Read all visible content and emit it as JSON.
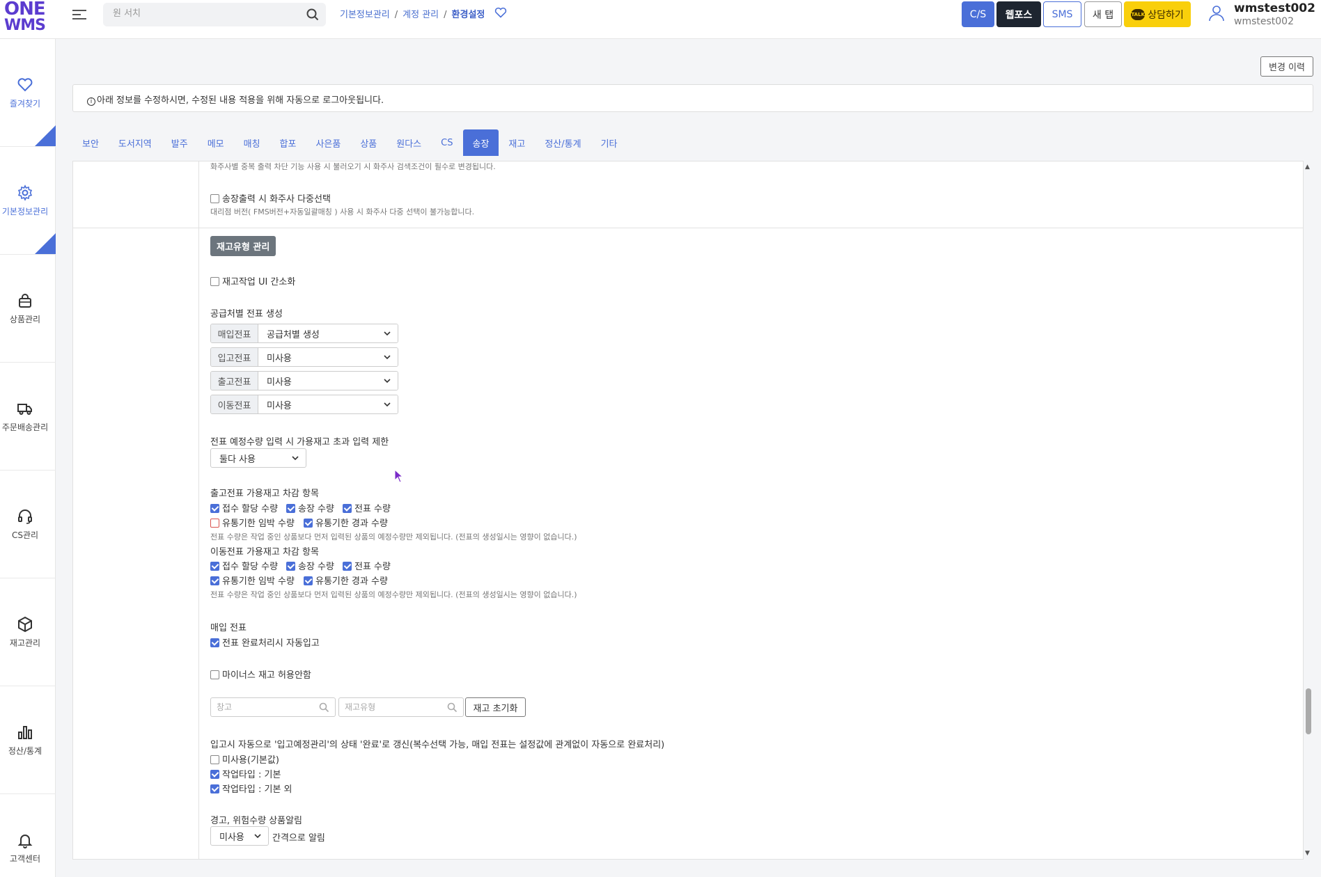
{
  "logo": {
    "line1": "ONE",
    "line2": "WMS"
  },
  "search": {
    "placeholder": "원 서치"
  },
  "breadcrumb": {
    "item1": "기본정보관리",
    "item2": "계정 관리",
    "current": "환경설정"
  },
  "topbar": {
    "cs": "C/S",
    "webpos": "웹포스",
    "sms": "SMS",
    "newtab": "새 탭",
    "talk_badge": "TALK",
    "consult": "상담하기"
  },
  "user": {
    "name": "wmstest002",
    "id": "wmstest002"
  },
  "sidebar": {
    "items": [
      {
        "label": "즐겨찾기",
        "icon": "heart-icon"
      },
      {
        "label": "기본정보관리",
        "icon": "gear-icon"
      },
      {
        "label": "상품관리",
        "icon": "bag-icon"
      },
      {
        "label": "주문배송관리",
        "icon": "truck-icon"
      },
      {
        "label": "CS관리",
        "icon": "headset-icon"
      },
      {
        "label": "재고관리",
        "icon": "box-icon"
      },
      {
        "label": "정산/통계",
        "icon": "bar-chart-icon"
      },
      {
        "label": "고객센터",
        "icon": "bell-icon"
      }
    ]
  },
  "history_btn": "변경 이력",
  "notice": "아래 정보를 수정하시면, 수정된 내용 적용을 위해 자동으로 로그아웃됩니다.",
  "tabs": [
    "보안",
    "도서지역",
    "발주",
    "메모",
    "매칭",
    "합포",
    "사은품",
    "상품",
    "원다스",
    "CS",
    "송장",
    "재고",
    "정산/통계",
    "기타"
  ],
  "active_tab": "송장",
  "top_section": {
    "note1": "화주사별 중복 출력 차단 기능 사용 시 불러오기 시 화주사 검색조건이 필수로 변경됩니다.",
    "multi_select_label": "송장출력 시 화주사 다중선택",
    "note2": "대리점 버전( FMS버전+자동일괄매칭 ) 사용 시 화주사 다중 선택이 불가능합니다."
  },
  "stock_section": {
    "title": "재고유형 관리",
    "simplify_label": "재고작업 UI 간소화",
    "supplier_slip_title": "공급처별 전표 생성",
    "slips": [
      {
        "addon": "매입전표",
        "value": "공급처별 생성"
      },
      {
        "addon": "입고전표",
        "value": "미사용"
      },
      {
        "addon": "출고전표",
        "value": "미사용"
      },
      {
        "addon": "이동전표",
        "value": "미사용"
      }
    ],
    "limit_title": "전표 예정수량 입력 시 가용재고 초과 입력 제한",
    "limit_value": "둘다 사용",
    "out_title": "출고전표 가용재고 차감 항목",
    "out_items": [
      {
        "label": "접수 할당 수량",
        "checked": true
      },
      {
        "label": "송장 수량",
        "checked": true
      },
      {
        "label": "전표 수량",
        "checked": true
      },
      {
        "label": "유통기한 임박 수량",
        "checked": false
      },
      {
        "label": "유통기한 경과 수량",
        "checked": true
      }
    ],
    "out_note": "전표 수량은 작업 중인 상품보다 먼저 입력된 상품의 예정수량만 제외됩니다. (전표의 생성일시는 영향이 없습니다.)",
    "move_title": "이동전표 가용재고 차감 항목",
    "move_items": [
      {
        "label": "접수 할당 수량",
        "checked": true
      },
      {
        "label": "송장 수량",
        "checked": true
      },
      {
        "label": "전표 수량",
        "checked": true
      },
      {
        "label": "유통기한 임박 수량",
        "checked": true
      },
      {
        "label": "유통기한 경과 수량",
        "checked": true
      }
    ],
    "move_note": "전표 수량은 작업 중인 상품보다 먼저 입력된 상품의 예정수량만 제외됩니다. (전표의 생성일시는 영향이 없습니다.)",
    "purchase_title": "매입 전표",
    "purchase_auto": "전표 완료처리시 자동입고",
    "minus_label": "마이너스 재고 허용안함",
    "warehouse_placeholder": "창고",
    "stocktype_placeholder": "재고유형",
    "reset_btn": "재고 초기화",
    "auto_status_title": "입고시 자동으로 '입고예정관리'의 상태 '완료'로 갱신(복수선택 가능, 매입 전표는 설정값에 관계없이 자동으로 완료처리)",
    "auto_status_items": [
      {
        "label": "미사용(기본값)",
        "checked": false
      },
      {
        "label": "작업타입 : 기본",
        "checked": true
      },
      {
        "label": "작업타입 : 기본 외",
        "checked": true
      }
    ],
    "alert_title": "경고, 위험수량 상품알림",
    "alert_value": "미사용",
    "alert_suffix": "간격으로 알림"
  },
  "colors": {
    "accent": "#4a6fd8",
    "brand": "#5b3ccf",
    "talk": "#f9cf0b"
  }
}
